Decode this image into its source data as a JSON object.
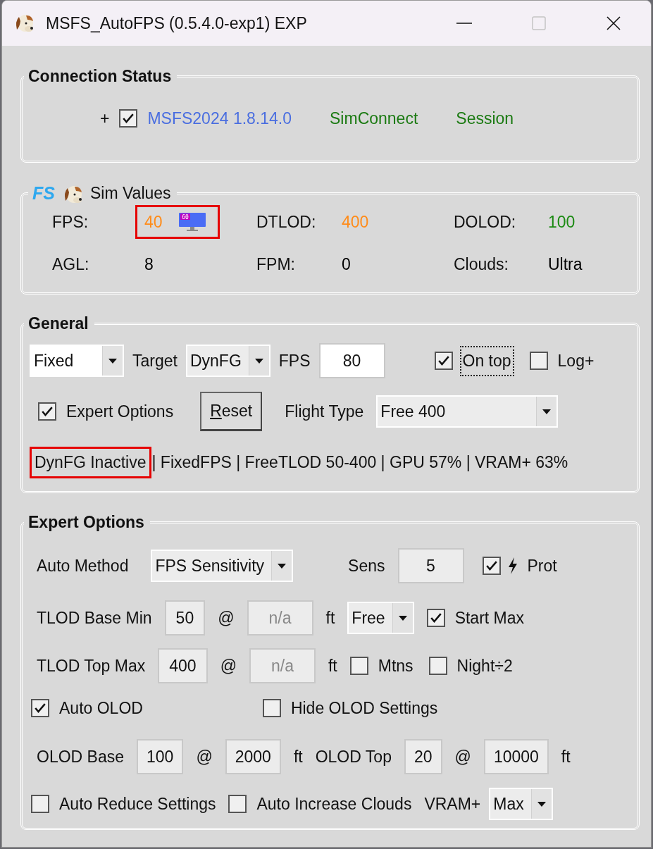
{
  "window": {
    "title": "MSFS_AutoFPS (0.5.4.0-exp1) EXP",
    "maximize_disabled": true
  },
  "connection_status": {
    "title": "Connection Status",
    "prefix": "+",
    "checked": true,
    "items": [
      {
        "text": "MSFS2024 1.8.14.0",
        "color": "#4a6ee0"
      },
      {
        "text": "SimConnect",
        "color": "#1b7a12"
      },
      {
        "text": "Session",
        "color": "#1b7a12"
      }
    ]
  },
  "sim_values": {
    "logo_text": "FS",
    "title": "Sim Values",
    "values": [
      {
        "label": "FPS:",
        "value": "40",
        "color": "#ff8c1a",
        "highlighted": true,
        "monitor_badge": "60"
      },
      {
        "label": "DTLOD:",
        "value": "400",
        "color": "#ff8c1a"
      },
      {
        "label": "DOLOD:",
        "value": "100",
        "color": "#1b8a12"
      },
      {
        "label": "AGL:",
        "value": "8",
        "color": "#000000"
      },
      {
        "label": "FPM:",
        "value": "0",
        "color": "#000000"
      },
      {
        "label": "Clouds:",
        "value": "Ultra",
        "color": "#000000"
      }
    ]
  },
  "general": {
    "title": "General",
    "row_1": [
      {
        "kind": "dropdown",
        "value": "Fixed",
        "focused": true
      },
      {
        "kind": "label",
        "text": "Target"
      },
      {
        "kind": "dropdown",
        "value": "DynFG",
        "focused": false
      },
      {
        "kind": "label",
        "text": "FPS"
      },
      {
        "kind": "field",
        "value": "80",
        "disabled": false
      },
      {
        "kind": "checkbox",
        "label": "On top",
        "checked": true,
        "focused": true
      },
      {
        "kind": "checkbox",
        "label": "Log+",
        "checked": false,
        "focused": false
      }
    ],
    "row_2": [
      {
        "kind": "checkbox",
        "label": "Expert Options",
        "checked": true,
        "focused": false
      },
      {
        "kind": "button",
        "label": "Reset",
        "underline_first": true
      },
      {
        "kind": "label",
        "text": "Flight Type"
      },
      {
        "kind": "dropdown",
        "value": "Free 400",
        "focused": false
      }
    ],
    "status": [
      {
        "text": "DynFG Inactive",
        "highlighted": true
      },
      {
        "text": "| FixedFPS | FreeTLOD 50-400 | GPU 57% | VRAM+ 63%",
        "highlighted": false
      }
    ]
  },
  "expert_options": {
    "title": "Expert Options",
    "rows": [
      {
        "controls": [
          {
            "kind": "label",
            "text": "Auto Method"
          },
          {
            "kind": "dropdown",
            "value": "FPS Sensitivity",
            "focused": false
          },
          {
            "kind": "label",
            "text": "Sens"
          },
          {
            "kind": "field",
            "value": "5",
            "disabled": false
          },
          {
            "kind": "checkbox",
            "label": "Prot",
            "checked": true,
            "bolt": true,
            "focused": false
          }
        ]
      },
      {
        "controls": [
          {
            "kind": "label",
            "text": "TLOD Base Min"
          },
          {
            "kind": "field",
            "value": "50",
            "disabled": false
          },
          {
            "kind": "label",
            "text": "@"
          },
          {
            "kind": "field",
            "value": "n/a",
            "disabled": true
          },
          {
            "kind": "label",
            "text": "ft"
          },
          {
            "kind": "dropdown",
            "value": "Free",
            "focused": false
          },
          {
            "kind": "checkbox",
            "label": "Start Max",
            "checked": true,
            "focused": false
          }
        ]
      },
      {
        "controls": [
          {
            "kind": "label",
            "text": "TLOD Top Max"
          },
          {
            "kind": "field",
            "value": "400",
            "disabled": false
          },
          {
            "kind": "label",
            "text": "@"
          },
          {
            "kind": "field",
            "value": "n/a",
            "disabled": true
          },
          {
            "kind": "label",
            "text": "ft"
          },
          {
            "kind": "checkbox",
            "label": "Mtns",
            "checked": false,
            "focused": false
          },
          {
            "kind": "checkbox",
            "label": "Night÷2",
            "checked": false,
            "focused": false
          }
        ]
      },
      {
        "controls": [
          {
            "kind": "checkbox",
            "label": "Auto OLOD",
            "checked": true,
            "focused": false
          },
          {
            "kind": "checkbox",
            "label": "Hide OLOD Settings",
            "checked": false,
            "focused": false
          }
        ]
      },
      {
        "controls": [
          {
            "kind": "label",
            "text": "OLOD Base"
          },
          {
            "kind": "field",
            "value": "100",
            "disabled": false
          },
          {
            "kind": "label",
            "text": "@"
          },
          {
            "kind": "field",
            "value": "2000",
            "disabled": false
          },
          {
            "kind": "label",
            "text": "ft"
          },
          {
            "kind": "label",
            "text": "OLOD Top"
          },
          {
            "kind": "field",
            "value": "20",
            "disabled": false
          },
          {
            "kind": "label",
            "text": "@"
          },
          {
            "kind": "field",
            "value": "10000",
            "disabled": false
          },
          {
            "kind": "label",
            "text": "ft"
          }
        ]
      },
      {
        "controls": [
          {
            "kind": "checkbox",
            "label": "Auto Reduce Settings",
            "checked": false,
            "focused": false
          },
          {
            "kind": "checkbox",
            "label": "Auto Increase Clouds",
            "checked": false,
            "focused": false
          },
          {
            "kind": "label",
            "text": "VRAM+"
          },
          {
            "kind": "dropdown",
            "value": "Max",
            "focused": false
          }
        ]
      }
    ]
  }
}
